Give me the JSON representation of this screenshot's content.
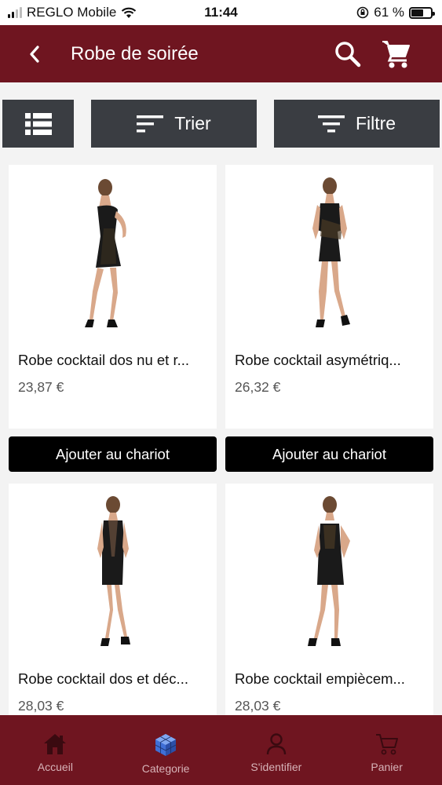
{
  "status": {
    "carrier": "REGLO Mobile",
    "time": "11:44",
    "battery": "61 %",
    "battery_level": 0.61
  },
  "header": {
    "title": "Robe de soirée"
  },
  "toolbar": {
    "sort_label": "Trier",
    "filter_label": "Filtre"
  },
  "products": [
    {
      "name": "Robe cocktail dos nu et r...",
      "price": "23,87 €",
      "button": "Ajouter au chariot"
    },
    {
      "name": "Robe cocktail asymétriq...",
      "price": "26,32 €",
      "button": "Ajouter au chariot"
    },
    {
      "name": "Robe cocktail dos et déc...",
      "price": "28,03 €"
    },
    {
      "name": "Robe cocktail empiècem...",
      "price": "28,03 €"
    }
  ],
  "nav": {
    "items": [
      {
        "label": "Accueil",
        "icon": "home-icon"
      },
      {
        "label": "Categorie",
        "icon": "cube-icon"
      },
      {
        "label": "S'identifier",
        "icon": "user-icon"
      },
      {
        "label": "Panier",
        "icon": "cart-icon"
      }
    ]
  },
  "colors": {
    "brand": "#6f1520",
    "toolbar": "#3a3d42",
    "button": "#000000"
  }
}
